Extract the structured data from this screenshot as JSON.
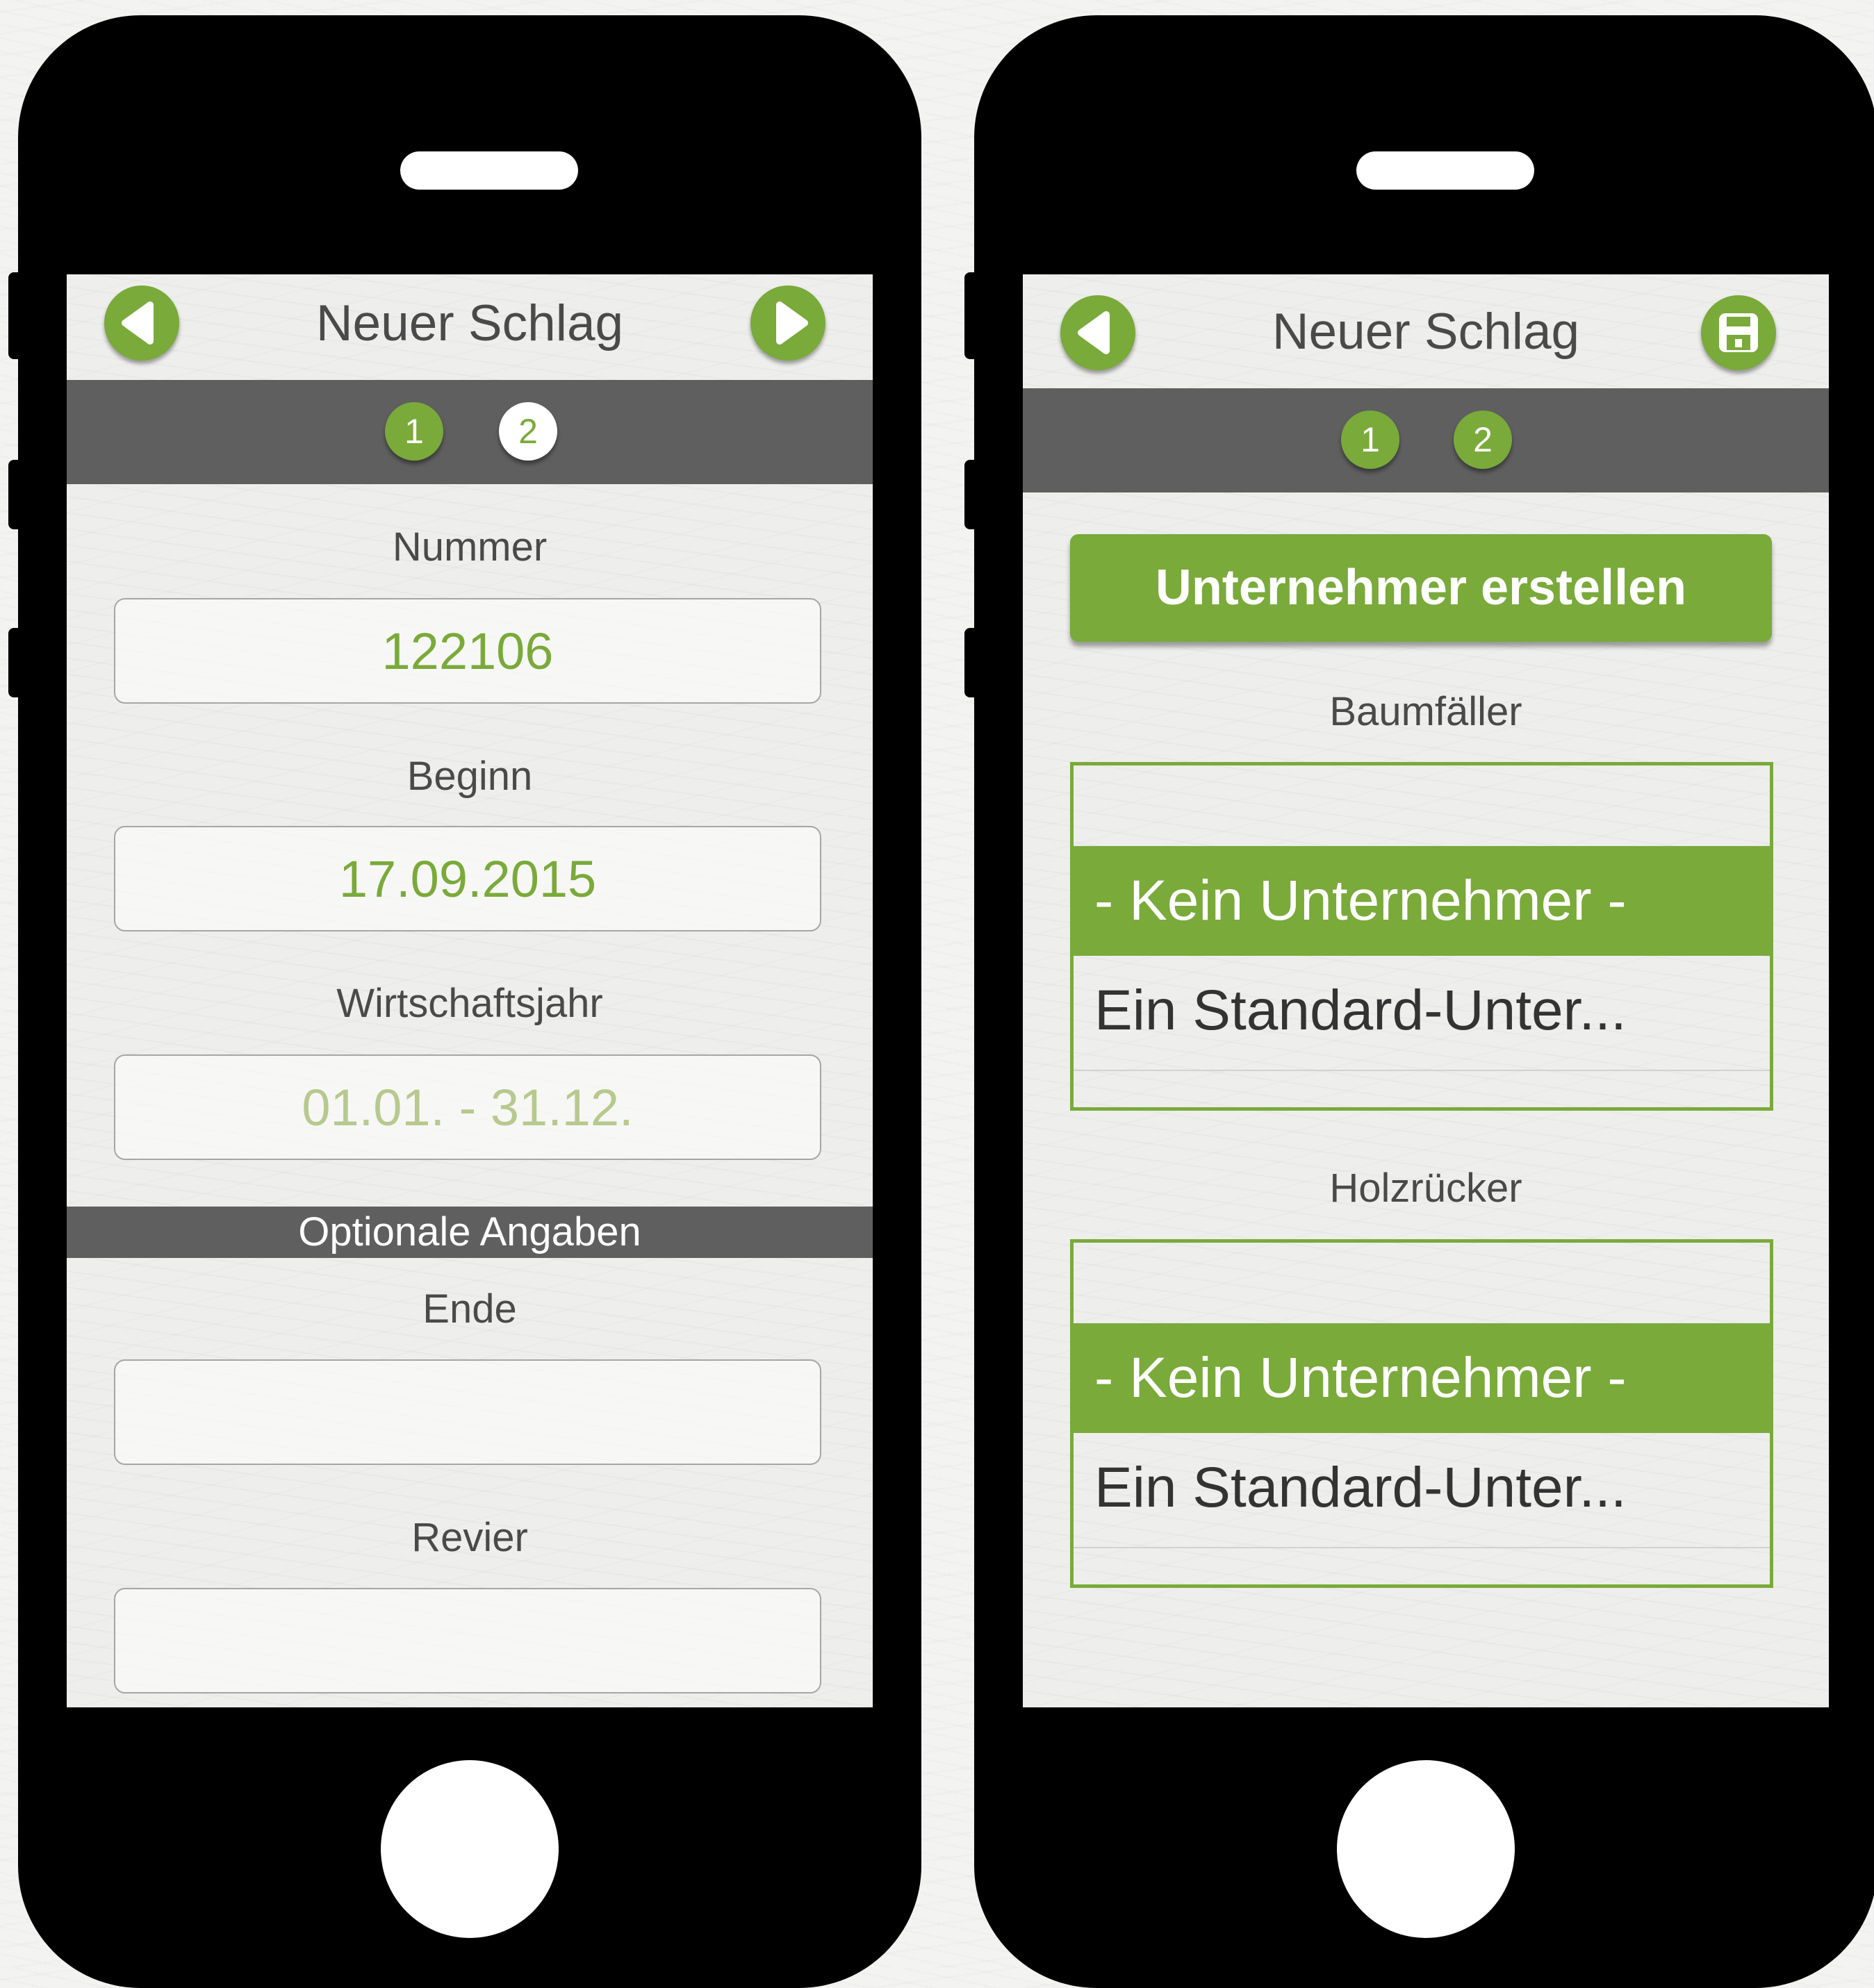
{
  "colors": {
    "accent": "#7aaa3a",
    "bar": "#5f5f5f",
    "device": "#000000"
  },
  "left_screen": {
    "title": "Neuer Schlag",
    "back_icon": "chevron-left-icon",
    "next_icon": "chevron-right-icon",
    "steps": [
      "1",
      "2"
    ],
    "fields": {
      "nummer": {
        "label": "Nummer",
        "value": "122106"
      },
      "beginn": {
        "label": "Beginn",
        "value": "17.09.2015"
      },
      "wirtschaftsjahr": {
        "label": "Wirtschaftsjahr",
        "value": "01.01. - 31.12."
      }
    },
    "section_title": "Optionale Angaben",
    "optional": {
      "ende": {
        "label": "Ende",
        "value": ""
      },
      "revier": {
        "label": "Revier",
        "value": ""
      }
    }
  },
  "right_screen": {
    "title": "Neuer Schlag",
    "back_icon": "chevron-left-icon",
    "save_icon": "save-icon",
    "steps": [
      "1",
      "2"
    ],
    "create_button": "Unternehmer erstellen",
    "baumfaeller": {
      "label": "Baumfäller",
      "selected": "- Kein Unternehmer -",
      "option": "Ein Standard-Unter..."
    },
    "holzruecker": {
      "label": "Holzrücker",
      "selected": "- Kein Unternehmer -",
      "option": "Ein Standard-Unter..."
    }
  }
}
